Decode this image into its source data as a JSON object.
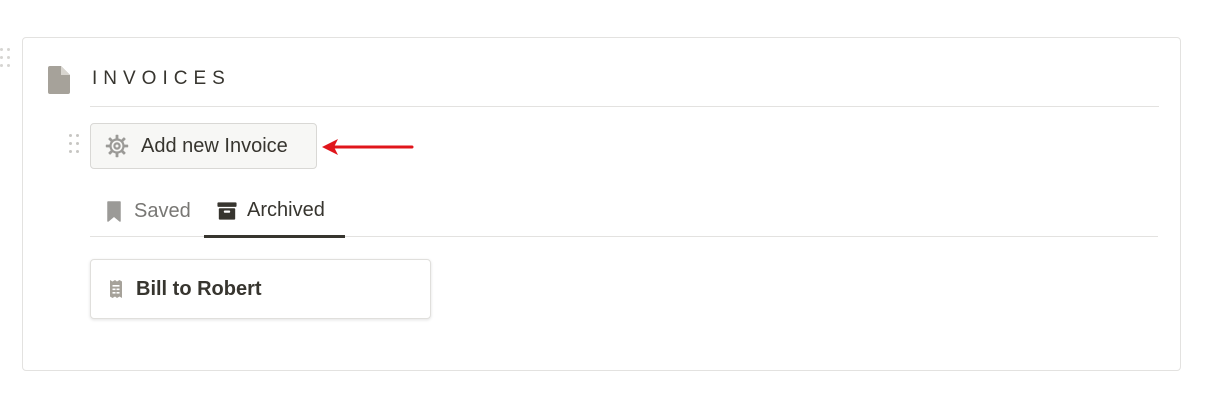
{
  "section": {
    "title": "INVOICES",
    "icon": "page-icon"
  },
  "toolbar": {
    "add_label": "Add new Invoice",
    "add_icon": "gear-icon"
  },
  "tabs": [
    {
      "label": "Saved",
      "icon": "bookmark-icon",
      "active": false
    },
    {
      "label": "Archived",
      "icon": "archive-icon",
      "active": true
    }
  ],
  "cards": [
    {
      "label": "Bill to Robert",
      "icon": "receipt-icon"
    }
  ],
  "colors": {
    "text": "#37352f",
    "muted": "#787774",
    "icon_gray": "#9b9a97",
    "arrow": "#e0151b",
    "border": "#e3e2e0"
  }
}
